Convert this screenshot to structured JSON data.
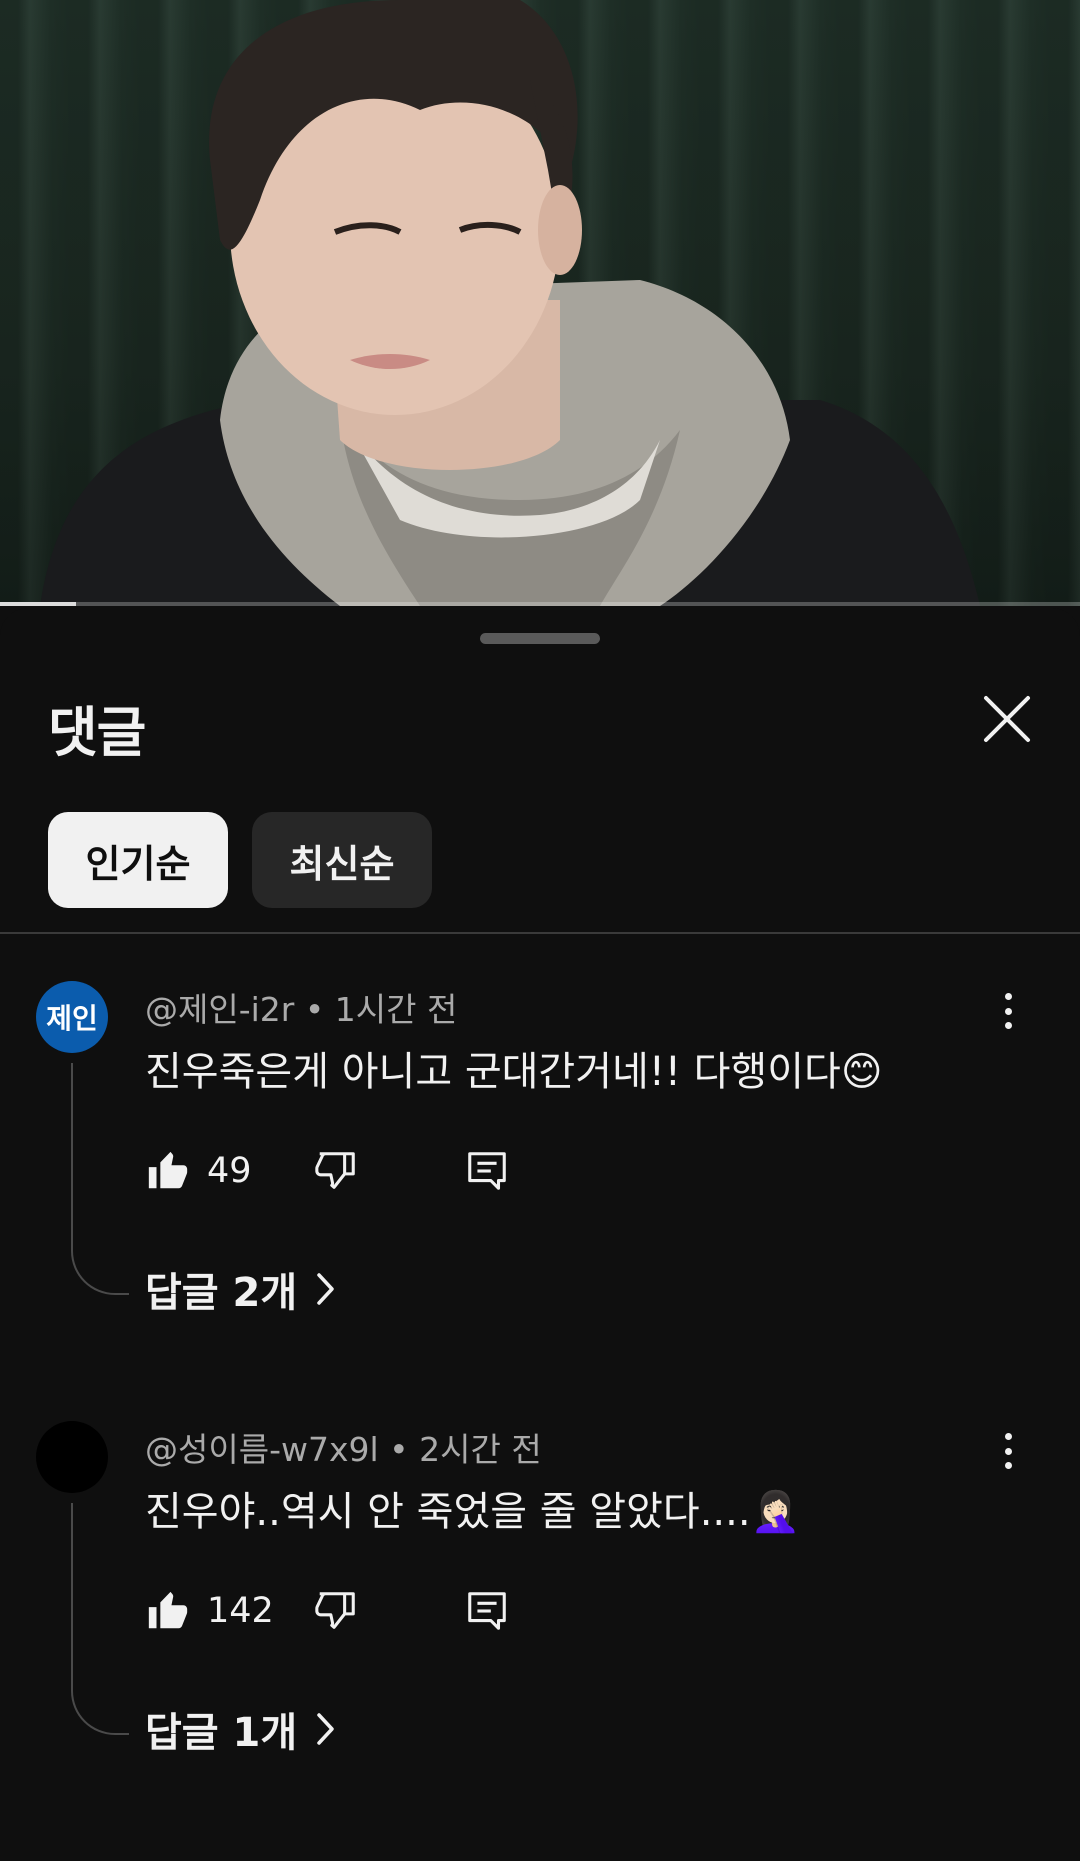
{
  "player": {
    "progress": 0.07,
    "scene": "video-frame-person-in-hoodie"
  },
  "comments_panel": {
    "title": "댓글",
    "close_icon": "close-icon",
    "sort_chips": [
      {
        "label": "인기순",
        "active": true
      },
      {
        "label": "최신순",
        "active": false
      }
    ],
    "comments": [
      {
        "avatar_text": "제인",
        "avatar_color": "#0b5cad",
        "author": "@제인-i2r",
        "time": "1시간 전",
        "meta": "@제인-i2r • 1시간 전",
        "text": "진우죽은게 아니고 군대간거네!! 다행이다😊",
        "likes": "49",
        "replies_label": "답글 2개"
      },
      {
        "avatar_text": "",
        "avatar_color": "#000000",
        "author": "@성이름-w7x9l",
        "time": "2시간 전",
        "meta": "@성이름-w7x9l • 2시간 전",
        "text": "진우야..역시 안 죽었을 줄 알았다....🤦🏻‍♀️",
        "likes": "142",
        "replies_label": "답글 1개"
      }
    ]
  },
  "colors": {
    "background": "#0f0f0f",
    "chip_active": "#f1f1f1",
    "chip_inactive": "#272727",
    "secondary_text": "#aaaaaa"
  }
}
